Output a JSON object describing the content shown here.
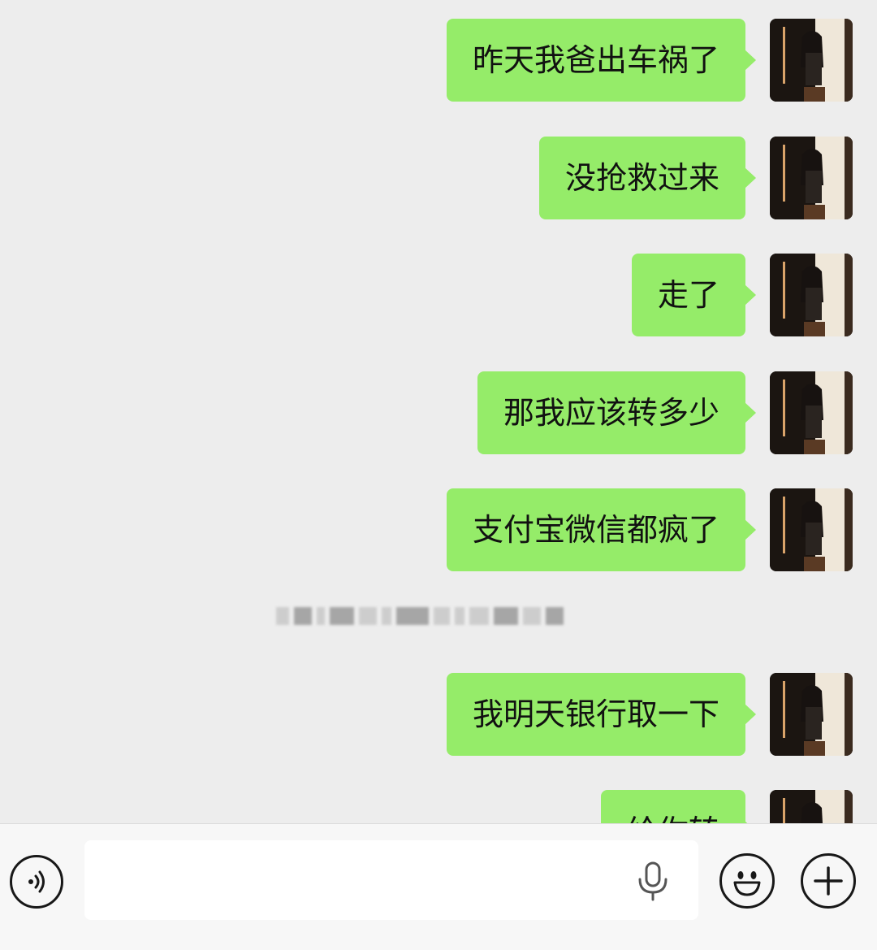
{
  "messages": [
    {
      "text": "昨天我爸出车祸了",
      "sender": "self"
    },
    {
      "text": "没抢救过来",
      "sender": "self"
    },
    {
      "text": "走了",
      "sender": "self"
    },
    {
      "text": "那我应该转多少",
      "sender": "self"
    },
    {
      "text": "支付宝微信都疯了",
      "sender": "self"
    },
    {
      "text": "我明天银行取一下",
      "sender": "self"
    },
    {
      "text": "给你转",
      "sender": "self"
    }
  ],
  "input": {
    "value": "",
    "placeholder": ""
  },
  "icons": {
    "voice": "voice-mode-icon",
    "mic": "microphone-icon",
    "emoji": "emoji-icon",
    "plus": "plus-icon"
  },
  "colors": {
    "bubble_self": "#95ec69",
    "chat_background": "#ededed",
    "input_bar_background": "#f7f7f7"
  }
}
